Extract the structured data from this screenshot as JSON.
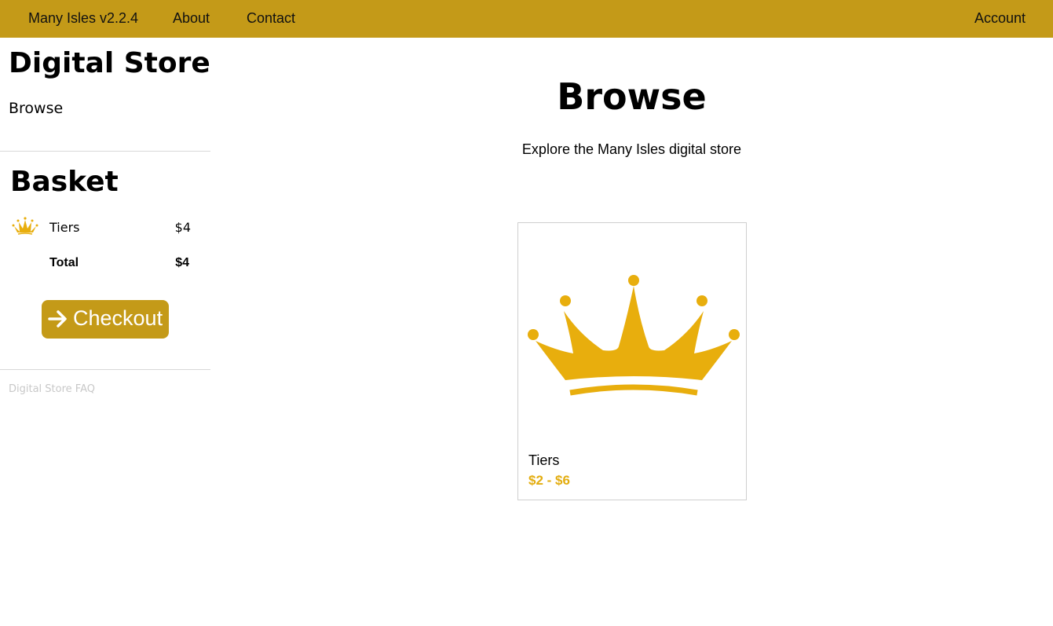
{
  "colors": {
    "brand": "#c49a18",
    "price": "#e3ad10",
    "crown": "#e8ae0d",
    "faq_link": "#c8c8c8"
  },
  "topbar": {
    "home_label": "Many Isles v2.2.4",
    "about_label": "About",
    "contact_label": "Contact",
    "account_label": "Account"
  },
  "sidebar": {
    "title": "Digital Store",
    "browse_label": "Browse",
    "faq_label": "Digital Store FAQ"
  },
  "basket": {
    "title": "Basket",
    "items": [
      {
        "name": "Tiers",
        "price": "$4",
        "icon": "crown-icon"
      }
    ],
    "total_label": "Total",
    "total_value": "$4",
    "checkout_label": "Checkout",
    "checkout_icon": "arrow-right-icon"
  },
  "main": {
    "title": "Browse",
    "subtitle": "Explore the Many Isles digital store",
    "products": [
      {
        "name": "Tiers",
        "price": "$2 - $6",
        "icon": "crown-icon"
      }
    ]
  }
}
